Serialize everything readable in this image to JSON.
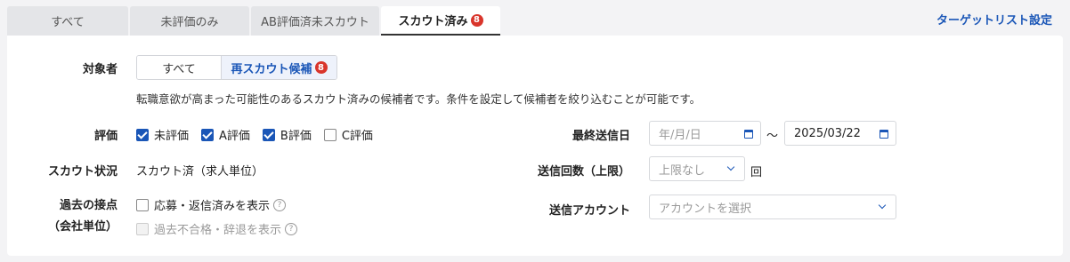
{
  "tabs": [
    {
      "label": "すべて"
    },
    {
      "label": "未評価のみ"
    },
    {
      "label": "AB評価済未スカウト"
    },
    {
      "label": "スカウト済み",
      "badge": "8"
    }
  ],
  "header": {
    "target_link": "ターゲットリスト設定"
  },
  "target": {
    "label": "対象者",
    "options": [
      {
        "label": "すべて"
      },
      {
        "label": "再スカウト候補",
        "badge": "8"
      }
    ],
    "description": "転職意欲が高まった可能性のあるスカウト済みの候補者です。条件を設定して候補者を絞り込むことが可能です。"
  },
  "rating": {
    "label": "評価",
    "options": [
      {
        "label": "未評価",
        "checked": true
      },
      {
        "label": "A評価",
        "checked": true
      },
      {
        "label": "B評価",
        "checked": true
      },
      {
        "label": "C評価",
        "checked": false
      }
    ]
  },
  "scout_status": {
    "label": "スカウト状況",
    "value": "スカウト済（求人単位）"
  },
  "past_contact": {
    "label_line1": "過去の接点",
    "label_line2": "（会社単位）",
    "option1": "応募・返信済みを表示",
    "option2": "過去不合格・辞退を表示"
  },
  "last_sent": {
    "label": "最終送信日",
    "from_placeholder": "年/月/日",
    "separator": "～",
    "to_value": "2025/03/22"
  },
  "send_count": {
    "label": "送信回数（上限）",
    "placeholder": "上限なし",
    "unit": "回"
  },
  "send_account": {
    "label": "送信アカウント",
    "placeholder": "アカウントを選択"
  },
  "colors": {
    "accent": "#1a56b7",
    "badge": "#d9352b"
  }
}
